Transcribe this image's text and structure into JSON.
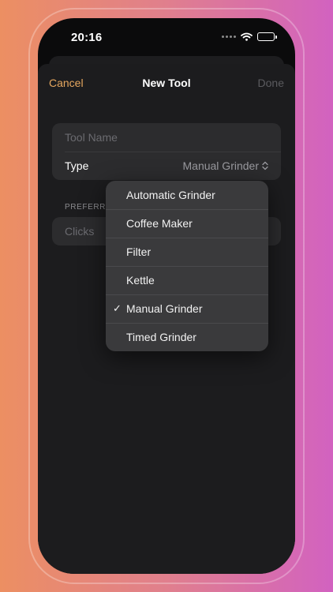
{
  "status_bar": {
    "time": "20:16"
  },
  "nav": {
    "cancel_label": "Cancel",
    "title": "New Tool",
    "done_label": "Done"
  },
  "form": {
    "tool_name_placeholder": "Tool Name",
    "type_label": "Type",
    "type_value": "Manual Grinder",
    "preferred_header": "PREFERRE",
    "clicks_placeholder": "Clicks"
  },
  "type_menu": {
    "options": [
      {
        "label": "Automatic Grinder",
        "selected": false
      },
      {
        "label": "Coffee Maker",
        "selected": false
      },
      {
        "label": "Filter",
        "selected": false
      },
      {
        "label": "Kettle",
        "selected": false
      },
      {
        "label": "Manual Grinder",
        "selected": true
      },
      {
        "label": "Timed Grinder",
        "selected": false
      }
    ],
    "check_glyph": "✓"
  },
  "colors": {
    "accent": "#e6a75f",
    "disabled": "#5b5b5f",
    "background_left": "#ec8f62",
    "background_right": "#d262c0"
  }
}
